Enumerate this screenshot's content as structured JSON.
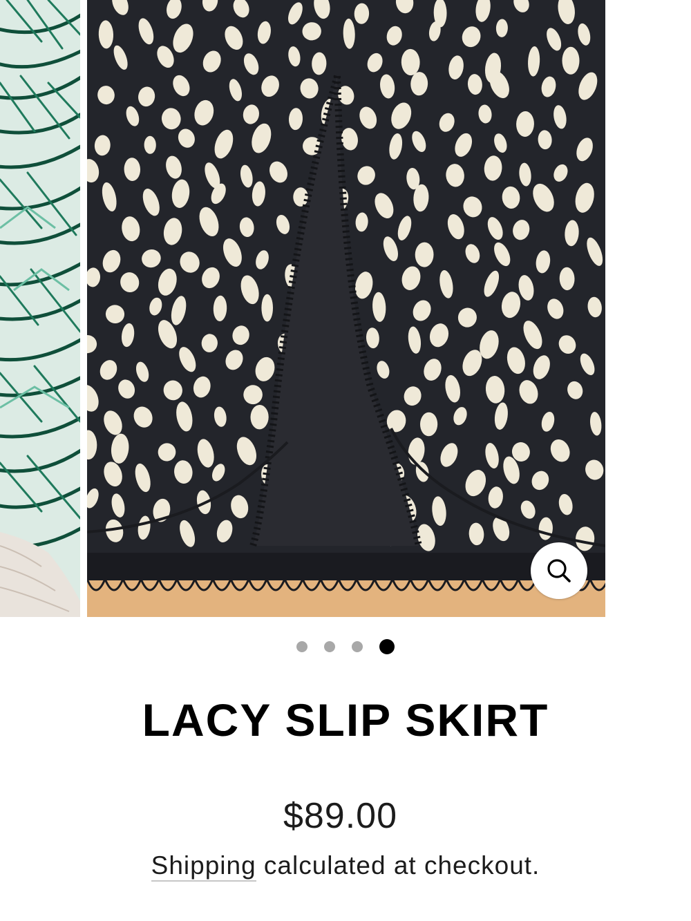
{
  "gallery": {
    "slide_count": 4,
    "active_index": 3,
    "slides": [
      {
        "name": "Slide 1"
      },
      {
        "name": "Slide 2"
      },
      {
        "name": "Slide 3"
      },
      {
        "name": "Slide 4"
      }
    ],
    "zoom_icon": "search-icon"
  },
  "product": {
    "title": "LACY SLIP SKIRT",
    "price": "$89.00",
    "shipping_link": "Shipping",
    "shipping_rest": " calculated at checkout."
  },
  "colors": {
    "fabric": "#23252b",
    "spot": "#efe9d8",
    "palm_green": "#0f4f3a",
    "dot_inactive": "#a8a8a8",
    "dot_active": "#000000"
  }
}
